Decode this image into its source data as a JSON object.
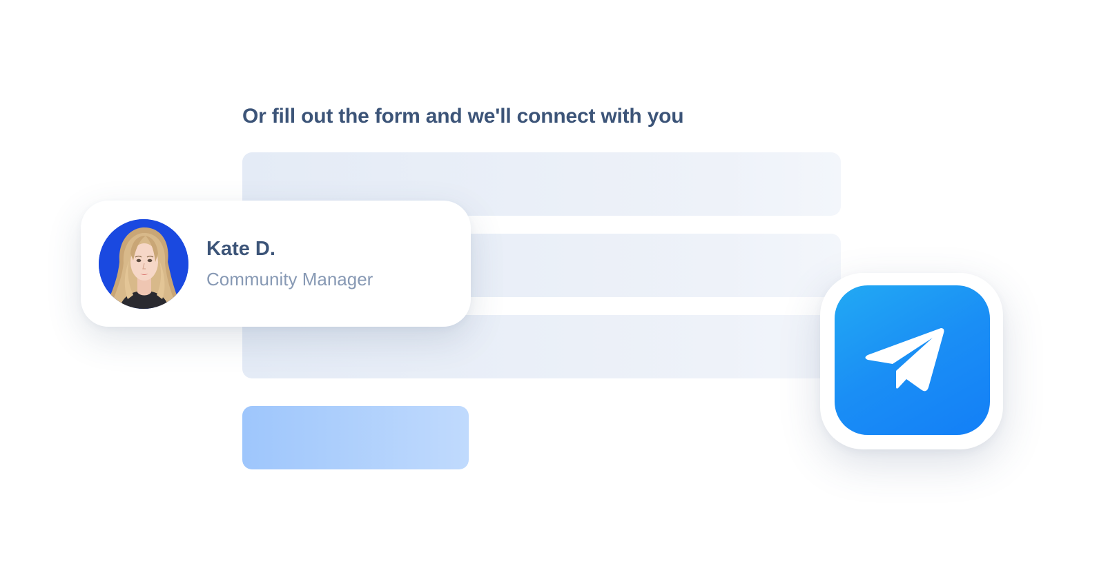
{
  "form": {
    "heading": "Or fill out the form and we'll connect with you"
  },
  "contact": {
    "name": "Kate D.",
    "role": "Community Manager",
    "avatar_background": "#1a49e0"
  },
  "telegram": {
    "icon": "telegram-paper-plane-icon",
    "color": "#1a8ef5"
  },
  "colors": {
    "heading": "#3c5478",
    "subtitle": "#8799b4",
    "field": "#e8eef7",
    "submit": "#aecffd"
  }
}
